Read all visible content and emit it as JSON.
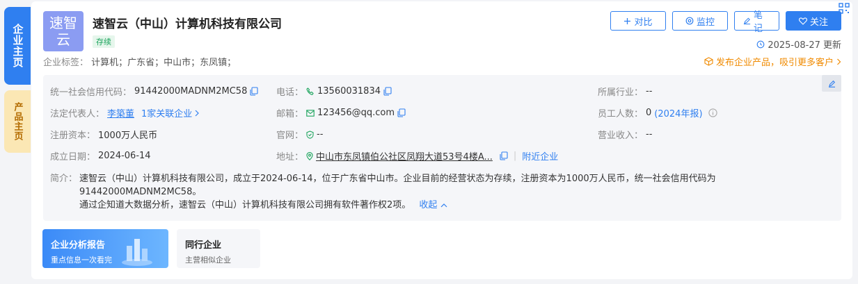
{
  "side_tabs": {
    "active": "企业主页",
    "alt": "产品主页"
  },
  "company": {
    "logo_text": "速智云",
    "name": "速智云（中山）计算机科技有限公司",
    "status": "存续",
    "tags_label": "企业标签：",
    "tags": "计算机；广东省；中山市；东凤镇；"
  },
  "actions": {
    "compare": "对比",
    "monitor": "监控",
    "notes": "笔记",
    "follow": "关注"
  },
  "update_text": "2025-08-27 更新",
  "publish_text": "发布企业产品，吸引更多客户",
  "info": {
    "credit_code_label": "统一社会信用代码：",
    "credit_code": "91442000MADNM2MC58",
    "phone_label": "电话：",
    "phone": "13560031834",
    "industry_label": "所属行业：",
    "industry": "--",
    "legal_rep_label": "法定代表人：",
    "legal_rep": "李築董",
    "related_companies": "1家关联企业",
    "email_label": "邮箱：",
    "email": "123456@qq.com",
    "employees_label": "员工人数：",
    "employees": "0",
    "employees_year": "(2024年报)",
    "capital_label": "注册资本：",
    "capital": "1000万人民币",
    "website_label": "官网：",
    "website": "--",
    "revenue_label": "营业收入：",
    "revenue": "--",
    "founded_label": "成立日期：",
    "founded": "2024-06-14",
    "address_label": "地址：",
    "address": "中山市东凤镇伯公社区凤翔大道53号4楼A...",
    "nearby": "附近企业",
    "intro_label": "简介：",
    "intro_line1": "速智云（中山）计算机科技有限公司，成立于2024-06-14，位于广东省中山市。企业目前的经营状态为存续，注册资本为1000万人民币，统一社会信用代码为",
    "intro_line2": "91442000MADNM2MC58。",
    "intro_line3": "通过企知道大数据分析，速智云（中山）计算机科技有限公司拥有软件著作权2项。",
    "collapse": "收起"
  },
  "report_card": {
    "title": "企业分析报告",
    "subtitle": "重点信息一次看完"
  },
  "peer_card": {
    "title": "同行企业",
    "subtitle": "主营相似企业"
  },
  "colors": {
    "primary": "#2f7ff0",
    "status_green": "#1aa35b",
    "orange": "#f08a00",
    "logo_bg": "#8b9cf2"
  }
}
